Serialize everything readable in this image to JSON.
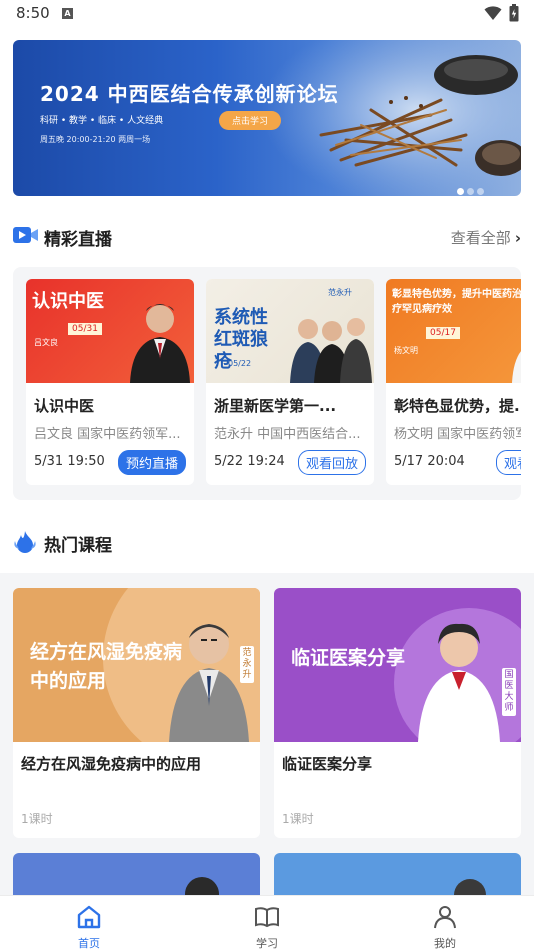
{
  "status_bar": {
    "time": "8:50",
    "notification_icon": "A"
  },
  "banner": {
    "title": "2024 中西医结合传承创新论坛",
    "tags": "科研 • 教学 • 临床 • 人文经典",
    "schedule": "周五晚 20:00-21:20 两周一场",
    "button_label": "点击学习",
    "pages": 3,
    "active_page": 1
  },
  "live_section": {
    "title": "精彩直播",
    "view_all": "查看全部",
    "cards": [
      {
        "thumb_title": "认识中医",
        "thumb_date": "05/31",
        "thumb_name": "吕文良",
        "title": "认识中医",
        "subtitle": "吕文良 国家中医药领军...",
        "date": "5/31 19:50",
        "button": "预约直播",
        "button_style": "solid"
      },
      {
        "thumb_title": "系统性红斑狼疮",
        "thumb_date": "05/22",
        "thumb_name": "范永升",
        "title": "浙里新医学第一...",
        "subtitle": "范永升 中国中西医结合...",
        "date": "5/22 19:24",
        "button": "观看回放",
        "button_style": "outline"
      },
      {
        "thumb_title": "彰显特色优势，提升中医药治疗罕见病疗效",
        "thumb_date": "05/17",
        "thumb_name": "杨文明",
        "title": "彰特色显优势，提...",
        "subtitle": "杨文明 国家中医药领军",
        "date": "5/17 20:04",
        "button": "观看回放",
        "button_style": "outline"
      }
    ]
  },
  "course_section": {
    "title": "热门课程",
    "courses": [
      {
        "thumb_text": "经方在风湿免疫病中的应用",
        "tag": "范永升",
        "title": "经方在风湿免疫病中的应用",
        "lessons": "1课时",
        "color": "#e5a662"
      },
      {
        "thumb_text": "临证医案分享",
        "tag": "国医大师",
        "title": "临证医案分享",
        "lessons": "1课时",
        "color": "#9a4fc8"
      }
    ]
  },
  "tabs": [
    {
      "label": "首页",
      "icon": "home-icon",
      "active": true
    },
    {
      "label": "学习",
      "icon": "book-icon",
      "active": false
    },
    {
      "label": "我的",
      "icon": "person-icon",
      "active": false
    }
  ],
  "colors": {
    "accent": "#2d72e8",
    "banner": "#2b63c9",
    "banner_button": "#f4a648"
  }
}
